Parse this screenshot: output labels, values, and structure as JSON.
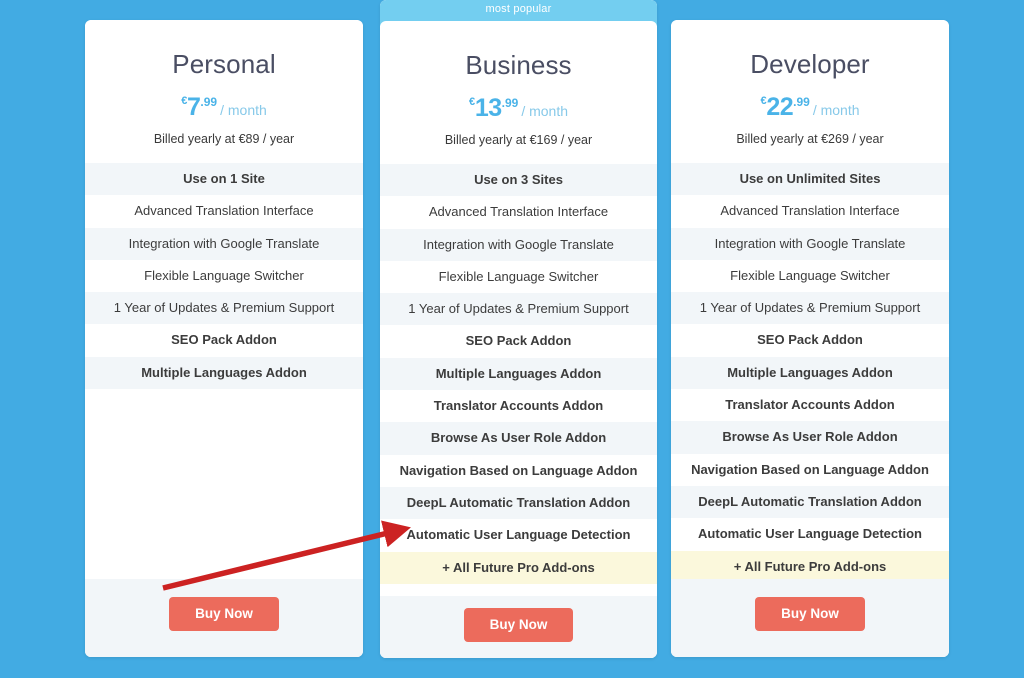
{
  "page": {
    "background_color": "#42abe3",
    "accent_color": "#4ab3e8",
    "cta_color": "#ec6b5c",
    "highlight_row_color": "#fbf8dc",
    "shade_row_color": "#f2f6f9",
    "ribbon_color": "#73cef0"
  },
  "plans": [
    {
      "id": "personal",
      "name": "Personal",
      "ribbon": null,
      "currency": "€",
      "amount": "7",
      "cents": ".99",
      "period": "/ month",
      "billed": "Billed yearly at €89 / year",
      "cta": "Buy Now",
      "features": [
        {
          "label": "Use on 1 Site",
          "bold": true,
          "style": "shade"
        },
        {
          "label": "Advanced Translation Interface",
          "bold": false,
          "style": "plain"
        },
        {
          "label": "Integration with Google Translate",
          "bold": false,
          "style": "shade"
        },
        {
          "label": "Flexible Language Switcher",
          "bold": false,
          "style": "plain"
        },
        {
          "label": "1 Year of Updates & Premium Support",
          "bold": false,
          "style": "shade"
        },
        {
          "label": "SEO Pack Addon",
          "bold": true,
          "style": "plain"
        },
        {
          "label": "Multiple Languages Addon",
          "bold": true,
          "style": "shade"
        }
      ]
    },
    {
      "id": "business",
      "name": "Business",
      "ribbon": "most popular",
      "currency": "€",
      "amount": "13",
      "cents": ".99",
      "period": "/ month",
      "billed": "Billed yearly at €169 / year",
      "cta": "Buy Now",
      "features": [
        {
          "label": "Use on 3 Sites",
          "bold": true,
          "style": "shade"
        },
        {
          "label": "Advanced Translation Interface",
          "bold": false,
          "style": "plain"
        },
        {
          "label": "Integration with Google Translate",
          "bold": false,
          "style": "shade"
        },
        {
          "label": "Flexible Language Switcher",
          "bold": false,
          "style": "plain"
        },
        {
          "label": "1 Year of Updates & Premium Support",
          "bold": false,
          "style": "shade"
        },
        {
          "label": "SEO Pack Addon",
          "bold": true,
          "style": "plain"
        },
        {
          "label": "Multiple Languages Addon",
          "bold": true,
          "style": "shade"
        },
        {
          "label": "Translator Accounts Addon",
          "bold": true,
          "style": "plain"
        },
        {
          "label": "Browse As User Role Addon",
          "bold": true,
          "style": "shade"
        },
        {
          "label": "Navigation Based on Language Addon",
          "bold": true,
          "style": "plain"
        },
        {
          "label": "DeepL Automatic Translation Addon",
          "bold": true,
          "style": "shade"
        },
        {
          "label": "Automatic User Language Detection",
          "bold": true,
          "style": "plain"
        },
        {
          "label": "+ All Future Pro Add-ons",
          "bold": true,
          "style": "highlight"
        }
      ]
    },
    {
      "id": "developer",
      "name": "Developer",
      "ribbon": null,
      "currency": "€",
      "amount": "22",
      "cents": ".99",
      "period": "/ month",
      "billed": "Billed yearly at €269 / year",
      "cta": "Buy Now",
      "features": [
        {
          "label": "Use on Unlimited Sites",
          "bold": true,
          "style": "shade"
        },
        {
          "label": "Advanced Translation Interface",
          "bold": false,
          "style": "plain"
        },
        {
          "label": "Integration with Google Translate",
          "bold": false,
          "style": "shade"
        },
        {
          "label": "Flexible Language Switcher",
          "bold": false,
          "style": "plain"
        },
        {
          "label": "1 Year of Updates & Premium Support",
          "bold": false,
          "style": "shade"
        },
        {
          "label": "SEO Pack Addon",
          "bold": true,
          "style": "plain"
        },
        {
          "label": "Multiple Languages Addon",
          "bold": true,
          "style": "shade"
        },
        {
          "label": "Translator Accounts Addon",
          "bold": true,
          "style": "plain"
        },
        {
          "label": "Browse As User Role Addon",
          "bold": true,
          "style": "shade"
        },
        {
          "label": "Navigation Based on Language Addon",
          "bold": true,
          "style": "plain"
        },
        {
          "label": "DeepL Automatic Translation Addon",
          "bold": true,
          "style": "shade"
        },
        {
          "label": "Automatic User Language Detection",
          "bold": true,
          "style": "plain"
        },
        {
          "label": "+ All Future Pro Add-ons",
          "bold": true,
          "style": "highlight"
        }
      ]
    }
  ],
  "annotation": {
    "type": "arrow",
    "color": "#cc2222",
    "points_to": "Automatic User Language Detection"
  }
}
